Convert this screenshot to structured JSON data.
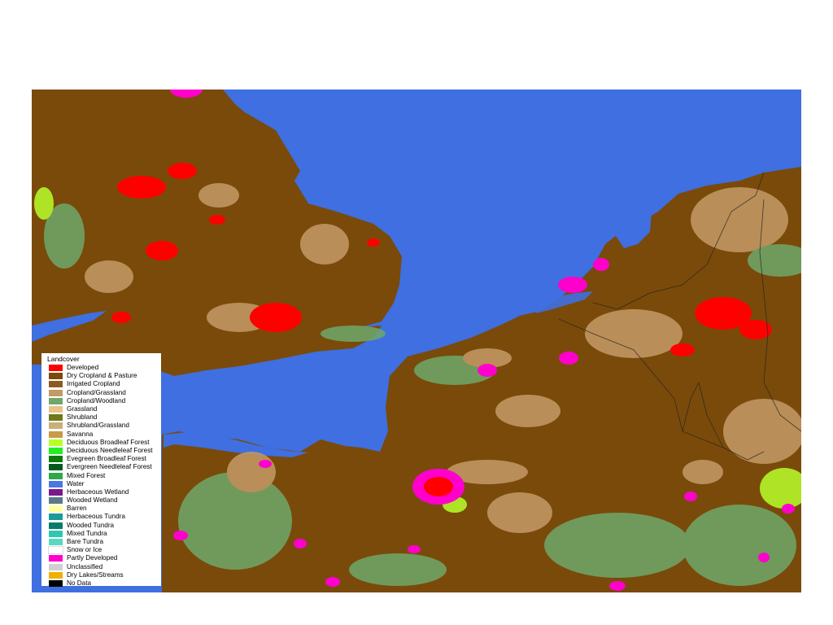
{
  "legend": {
    "title": "Landcover",
    "items": [
      {
        "label": "Developed",
        "color": "#ff0000"
      },
      {
        "label": "Dry Cropland & Pasture",
        "color": "#7a4a0a"
      },
      {
        "label": "Irrigated Cropland",
        "color": "#8b5a22"
      },
      {
        "label": "Cropland/Grassland",
        "color": "#c49a66"
      },
      {
        "label": "Cropland/Woodland",
        "color": "#6fa86a"
      },
      {
        "label": "Grassland",
        "color": "#e8c48a"
      },
      {
        "label": "Shrubland",
        "color": "#6e7a1c"
      },
      {
        "label": "Shrubland/Grassland",
        "color": "#c8b078"
      },
      {
        "label": "Savanna",
        "color": "#c89a4a"
      },
      {
        "label": "Deciduous Broadleaf Forest",
        "color": "#b8ff2a"
      },
      {
        "label": "Deciduous Needleleaf Forest",
        "color": "#22ee22"
      },
      {
        "label": "Evegreen Broadleaf Forest",
        "color": "#0d7a0d"
      },
      {
        "label": "Evergreen Needleleaf Forest",
        "color": "#005a1e"
      },
      {
        "label": "Mixed Forest",
        "color": "#2ea84a"
      },
      {
        "label": "Water",
        "color": "#4a78e0"
      },
      {
        "label": "Herbaceous Wetland",
        "color": "#7a1a8a"
      },
      {
        "label": "Wooded Wetland",
        "color": "#5a7a8a"
      },
      {
        "label": "Barren",
        "color": "#ffffa0"
      },
      {
        "label": "Herbaceous Tundra",
        "color": "#1a9a9a"
      },
      {
        "label": "Wooded Tundra",
        "color": "#0a7a6a"
      },
      {
        "label": "Mixed Tundra",
        "color": "#2ec8b0"
      },
      {
        "label": "Bare Tundra",
        "color": "#5ad8c0"
      },
      {
        "label": "Snow or Ice",
        "color": "#ffffff"
      },
      {
        "label": "Partly Developed",
        "color": "#ff00cc"
      },
      {
        "label": "Unclassified",
        "color": "#d0d0d0"
      },
      {
        "label": "Dry Lakes/Streams",
        "color": "#f0b000"
      },
      {
        "label": "No Data",
        "color": "#000000"
      }
    ]
  }
}
